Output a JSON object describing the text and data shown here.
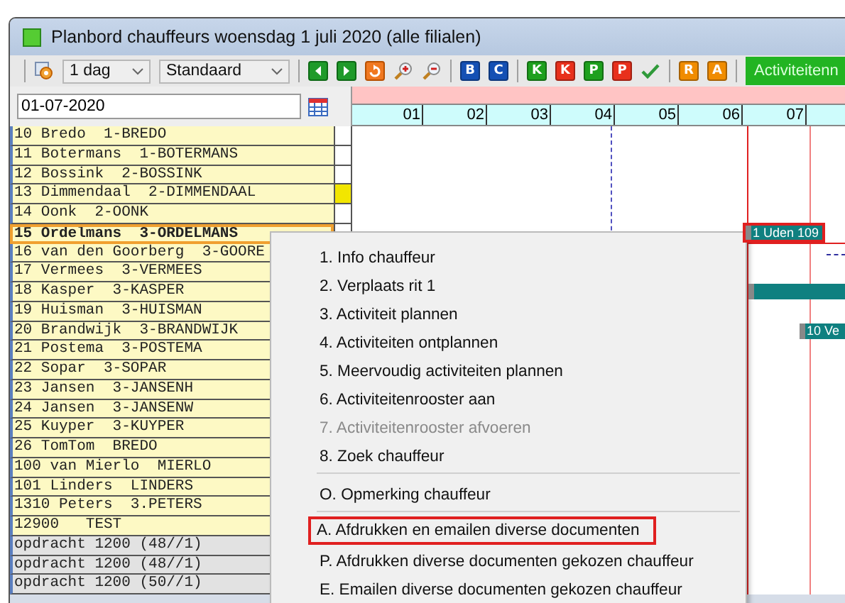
{
  "window": {
    "title": "Planbord chauffeurs woensdag 1 juli 2020 (alle filialen)"
  },
  "toolbar": {
    "period": "1 dag",
    "view": "Standaard",
    "nav": [
      {
        "kind": "prev"
      },
      {
        "kind": "next"
      },
      {
        "kind": "today"
      },
      {
        "kind": "zoom-in"
      },
      {
        "kind": "zoom-out"
      }
    ],
    "buttons": [
      {
        "kind": "letter",
        "label": "B",
        "color": "#1450b4"
      },
      {
        "kind": "letter",
        "label": "C",
        "color": "#1450b4"
      },
      {
        "kind": "letter",
        "label": "K",
        "color": "#1ea01e"
      },
      {
        "kind": "letter",
        "label": "K",
        "color": "#e8301c"
      },
      {
        "kind": "letter",
        "label": "P",
        "color": "#1ea01e"
      },
      {
        "kind": "letter",
        "label": "P",
        "color": "#e8301c"
      },
      {
        "kind": "check"
      },
      {
        "kind": "letter",
        "label": "R",
        "color": "#f08c00"
      },
      {
        "kind": "letter",
        "label": "A",
        "color": "#f08c00"
      }
    ],
    "action": "Activiteitenn"
  },
  "date_field": {
    "value": "01-07-2020"
  },
  "hours": [
    "01",
    "02",
    "03",
    "04",
    "05",
    "06",
    "07"
  ],
  "rows": [
    {
      "kind": "driver",
      "text": "10 Bredo  1-BREDO",
      "selected": false,
      "flag": false
    },
    {
      "kind": "driver",
      "text": "11 Botermans  1-BOTERMANS",
      "selected": false,
      "flag": false
    },
    {
      "kind": "driver",
      "text": "12 Bossink  2-BOSSINK",
      "selected": false,
      "flag": false
    },
    {
      "kind": "driver",
      "text": "13 Dimmendaal  2-DIMMENDAAL",
      "selected": false,
      "flag": true
    },
    {
      "kind": "driver",
      "text": "14 Oonk  2-OONK",
      "selected": false,
      "flag": false
    },
    {
      "kind": "driver",
      "text": "15 Ordelmans  3-ORDELMANS",
      "selected": true,
      "flag": false,
      "bars": [
        {
          "label": "1 Uden 109",
          "selected": true
        }
      ]
    },
    {
      "kind": "driver",
      "text": "16 van den Goorberg  3-GOORE",
      "selected": false
    },
    {
      "kind": "driver",
      "text": "17 Vermees  3-VERMEES",
      "selected": false
    },
    {
      "kind": "driver",
      "text": "18 Kasper  3-KASPER",
      "selected": false,
      "bars": [
        {
          "selected": false
        }
      ]
    },
    {
      "kind": "driver",
      "text": "19 Huisman  3-HUISMAN",
      "selected": false
    },
    {
      "kind": "driver",
      "text": "20 Brandwijk  3-BRANDWIJK",
      "selected": false,
      "bars": [
        {
          "label": "10 Ve",
          "selected": false
        }
      ]
    },
    {
      "kind": "driver",
      "text": "21 Postema  3-POSTEMA",
      "selected": false
    },
    {
      "kind": "driver",
      "text": "22 Sopar  3-SOPAR",
      "selected": false
    },
    {
      "kind": "driver",
      "text": "23 Jansen  3-JANSENH",
      "selected": false
    },
    {
      "kind": "driver",
      "text": "24 Jansen  3-JANSENW",
      "selected": false
    },
    {
      "kind": "driver",
      "text": "25 Kuyper  3-KUYPER",
      "selected": false
    },
    {
      "kind": "driver",
      "text": "26 TomTom  BREDO",
      "selected": false
    },
    {
      "kind": "driver",
      "text": "100 van Mierlo  MIERLO",
      "selected": false
    },
    {
      "kind": "driver",
      "text": "101 Linders  LINDERS",
      "selected": false
    },
    {
      "kind": "driver",
      "text": "1310 Peters  3.PETERS",
      "selected": false
    },
    {
      "kind": "driver",
      "text": "12900   TEST",
      "selected": false
    },
    {
      "kind": "order",
      "text": "opdracht 1200 (48//1)",
      "selected": false
    },
    {
      "kind": "order",
      "text": "opdracht 1200 (48//1)",
      "selected": false
    },
    {
      "kind": "order",
      "text": "opdracht 1200 (50//1)",
      "selected": false
    }
  ],
  "context_menu": [
    {
      "kind": "item",
      "label": "1. Info chauffeur",
      "disabled": false,
      "highlighted": false
    },
    {
      "kind": "item",
      "label": "2. Verplaats rit 1",
      "disabled": false,
      "highlighted": false
    },
    {
      "kind": "item",
      "label": "3. Activiteit plannen",
      "disabled": false,
      "highlighted": false
    },
    {
      "kind": "item",
      "label": "4. Activiteiten ontplannen",
      "disabled": false,
      "highlighted": false
    },
    {
      "kind": "item",
      "label": "5. Meervoudig activiteiten plannen",
      "disabled": false,
      "highlighted": false
    },
    {
      "kind": "item",
      "label": "6. Activiteitenrooster aan",
      "disabled": false,
      "highlighted": false
    },
    {
      "kind": "item",
      "label": "7. Activiteitenrooster afvoeren",
      "disabled": true,
      "highlighted": false
    },
    {
      "kind": "item",
      "label": "8. Zoek chauffeur",
      "disabled": false,
      "highlighted": false
    },
    {
      "kind": "separator"
    },
    {
      "kind": "item",
      "label": "O. Opmerking chauffeur",
      "disabled": false,
      "highlighted": false
    },
    {
      "kind": "separator"
    },
    {
      "kind": "item",
      "label": "A. Afdrukken en emailen diverse documenten",
      "disabled": false,
      "highlighted": true
    },
    {
      "kind": "item",
      "label": "P. Afdrukken diverse documenten gekozen chauffeur",
      "disabled": false,
      "highlighted": false
    },
    {
      "kind": "item",
      "label": "E. Emailen diverse documenten gekozen chauffeur",
      "disabled": false,
      "highlighted": false
    }
  ]
}
